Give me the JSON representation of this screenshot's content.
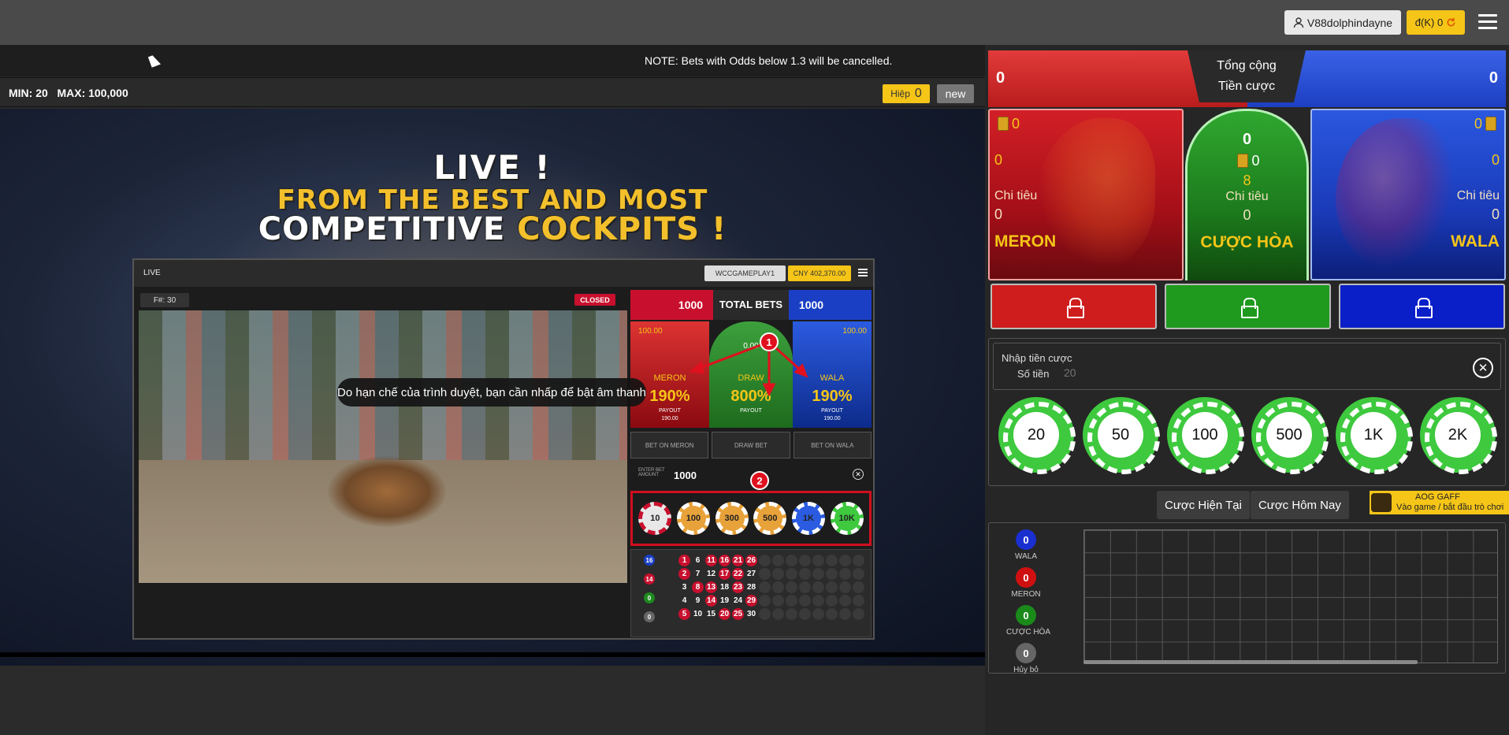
{
  "topbar": {
    "username": "V88dolphindayne",
    "balance": "đ(K) 0",
    "refresh_icon": "refresh-icon",
    "menu_icon": "hamburger-icon"
  },
  "notice": "NOTE: Bets with Odds below 1.3 will be cancelled.",
  "limits": {
    "text": "MIN: 20   MAX: 100,000",
    "hiep_label": "Hiệp",
    "hiep_value": "0",
    "new_label": "new"
  },
  "video": {
    "line1": "LIVE !",
    "line2": "FROM THE BEST AND MOST",
    "line3a": "COMPETITIVE",
    "line3b": "COCKPITS !",
    "sound_tooltip": "Do hạn chế của trình duyệt, bạn cần nhấp để bật âm thanh",
    "inner": {
      "live": "LIVE",
      "user": "WCCGAMEPLAY1",
      "balance": "CNY 402,370.00",
      "fight": "F#: 30",
      "status": "CLOSED",
      "total_bets": "TOTAL BETS",
      "meron_total": "1000",
      "wala_total": "1000",
      "meron_top": "100.00",
      "draw_top": "0.00",
      "wala_top": "100.00",
      "meron": {
        "name": "MERON",
        "pct": "190%",
        "payout": "PAYOUT",
        "amount": "190.00"
      },
      "draw": {
        "name": "DRAW",
        "pct": "800%",
        "payout": "PAYOUT"
      },
      "wala": {
        "name": "WALA",
        "pct": "190%",
        "payout": "PAYOUT",
        "amount": "190.00"
      },
      "bet_meron": "BET ON MERON",
      "draw_bet": "DRAW BET",
      "bet_wala": "BET ON WALA",
      "enter_label": "ENTER BET AMOUNT",
      "enter_value": "1000",
      "chips": [
        "10",
        "100",
        "300",
        "500",
        "1K",
        "10K"
      ],
      "chip_colors": [
        "#e8e8e8",
        "#e8a23a",
        "#e8a23a",
        "#e8a23a",
        "#2b5be0",
        "#3ec93e"
      ],
      "road_side": [
        "16",
        "14",
        "0",
        "0"
      ],
      "road_cols": [
        [
          "1",
          "2",
          "3",
          "4",
          "5"
        ],
        [
          "6",
          "7",
          "8",
          "9",
          "10"
        ],
        [
          "11",
          "12",
          "13",
          "14",
          "15"
        ],
        [
          "16",
          "17",
          "18",
          "19",
          "20"
        ],
        [
          "21",
          "22",
          "23",
          "24",
          "25"
        ],
        [
          "26",
          "27",
          "28",
          "29",
          "30"
        ]
      ],
      "marker1": "1",
      "marker2": "2"
    }
  },
  "right": {
    "total_meron": "0",
    "total_wala": "0",
    "total_label1": "Tổng cộng",
    "total_label2": "Tiền cược",
    "meron": {
      "coins": "0",
      "value": "0",
      "limit_label": "Chi tiêu",
      "limit_value": "0",
      "name": "MERON"
    },
    "draw": {
      "top": "0",
      "coins": "0",
      "value": "8",
      "limit_label": "Chi tiêu",
      "limit_value": "0",
      "name": "CƯỢC HÒA"
    },
    "wala": {
      "coins": "0",
      "value": "0",
      "limit_label": "Chi tiêu",
      "limit_value": "0",
      "name": "WALA"
    },
    "bet_input": {
      "label1": "Nhập tiền cược",
      "label2": "Số tiền",
      "placeholder": "20"
    },
    "chips": [
      "20",
      "50",
      "100",
      "500",
      "1K",
      "2K"
    ],
    "tabs": [
      "Cược Hiện Tại",
      "Cược Hôm Nay"
    ],
    "aog": {
      "title": "AOG GAFF",
      "subtitle": "Vào game / bắt đầu trò chơi"
    },
    "legend": [
      {
        "value": "0",
        "label": "WALA",
        "color": "#1a2fd0"
      },
      {
        "value": "0",
        "label": "MERON",
        "color": "#d01010"
      },
      {
        "value": "0",
        "label": "CƯỢC HÒA",
        "color": "#1a8a1a"
      },
      {
        "value": "0",
        "label": "Hủy bỏ",
        "color": "#666666"
      }
    ]
  }
}
